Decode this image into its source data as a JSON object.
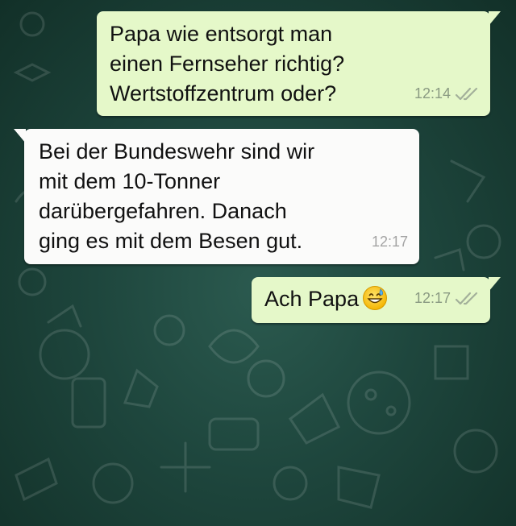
{
  "messages": [
    {
      "direction": "outgoing",
      "text": "Papa wie entsorgt man\neinen Fernseher richtig?\nWertstoffzentrum oder?",
      "time": "12:14",
      "status_icon": "double-check-icon"
    },
    {
      "direction": "incoming",
      "text": "Bei der Bundeswehr sind wir\nmit dem 10-Tonner\ndarübergefahren. Danach\nging es mit dem Besen gut.",
      "time": "12:17"
    },
    {
      "direction": "outgoing",
      "text": "Ach Papa",
      "emoji": "grinning-sweat-emoji-icon",
      "time": "12:17",
      "status_icon": "double-check-icon"
    }
  ],
  "colors": {
    "outgoing_bubble": "#e5f8c9",
    "incoming_bubble": "#fbfbfa",
    "wallpaper": "#1e463d",
    "meta_text": "#8a9a82"
  }
}
